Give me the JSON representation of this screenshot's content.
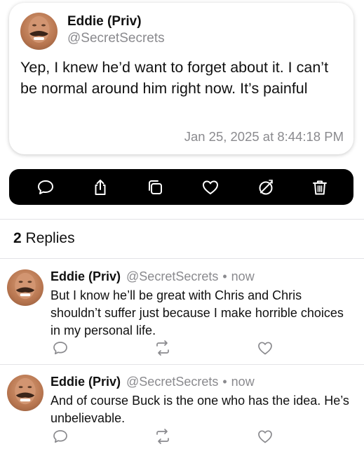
{
  "post": {
    "author_name": "Eddie (Priv)",
    "author_handle": "@SecretSecrets",
    "text": "Yep, I knew he’d want to forget about it. I can’t be normal around him right now. It’s painful",
    "timestamp": "Jan 25, 2025 at 8:44:18 PM"
  },
  "toolbar": {
    "icons": [
      "reply-icon",
      "share-icon",
      "copy-icon",
      "like-icon",
      "hide-icon",
      "delete-icon"
    ],
    "background": "#000000",
    "icon_color": "#ffffff"
  },
  "replies_section": {
    "count": "2",
    "label": "Replies"
  },
  "replies": [
    {
      "author_name": "Eddie (Priv)",
      "author_handle": "@SecretSecrets",
      "separator": "•",
      "time": "now",
      "text": "But I know he’ll be great with Chris and Chris shouldn’t suffer just because I make horrible choices in my personal life."
    },
    {
      "author_name": "Eddie (Priv)",
      "author_handle": "@SecretSecrets",
      "separator": "•",
      "time": "now",
      "text": "And of course Buck is the one who has the idea. He’s unbelievable."
    }
  ],
  "colors": {
    "secondary_text": "#8a8a8e",
    "primary_text": "#111111",
    "divider": "#e3e3e6"
  }
}
